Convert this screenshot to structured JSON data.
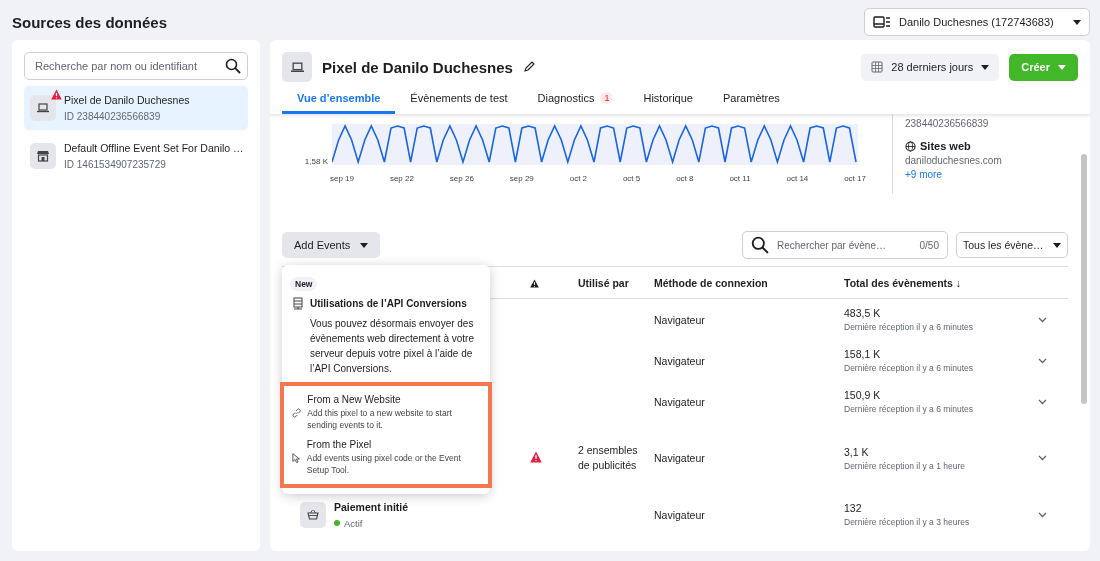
{
  "page_title": "Sources des données",
  "account": {
    "label": "Danilo Duchesnes (172743683)"
  },
  "sidebar": {
    "search": {
      "placeholder": "Recherche par nom ou identifiant"
    },
    "items": [
      {
        "kind": "pixel",
        "name": "Pixel de Danilo Duchesnes",
        "id": "ID 238440236566839",
        "selected": true,
        "warning": true
      },
      {
        "kind": "offline",
        "name": "Default Offline Event Set For Danilo …",
        "id": "ID 1461534907235729",
        "selected": false,
        "warning": false
      }
    ]
  },
  "main": {
    "title": "Pixel de Danilo Duchesnes",
    "date_range": "28 derniers jours",
    "create_button": "Créer",
    "tabs": [
      {
        "label": "Vue d’ensemble",
        "selected": true
      },
      {
        "label": "Évènements de test",
        "selected": false
      },
      {
        "label": "Diagnostics",
        "selected": false,
        "badge": "1"
      },
      {
        "label": "Historique",
        "selected": false
      },
      {
        "label": "Paramètres",
        "selected": false
      }
    ]
  },
  "chart": {
    "y_label": "1,58 K",
    "x_labels": [
      "sep 19",
      "sep 22",
      "sep 26",
      "sep 29",
      "oct 2",
      "oct 5",
      "oct 8",
      "oct 11",
      "oct 14",
      "oct 17"
    ]
  },
  "details": {
    "pixel_id": "238440236566839",
    "websites_title": "Sites web",
    "website": "daniloduchesnes.com",
    "more_link": "+9 more"
  },
  "toolbar": {
    "add_events": "Add Events",
    "search": {
      "placeholder": "Rechercher par évène…",
      "counter": "0/50"
    },
    "filter": "Tous les évène…"
  },
  "table": {
    "columns": [
      "Utilisé par",
      "Méthode de connexion",
      "Total des évènements ↓"
    ],
    "rows": [
      {
        "warning": false,
        "method": "Navigateur",
        "total": "483,5 K",
        "last_received": "Dernière réception il y a 6 minutes"
      },
      {
        "warning": false,
        "method": "Navigateur",
        "total": "158,1 K",
        "last_received": "Dernière réception il y a 6 minutes"
      },
      {
        "warning": false,
        "method": "Navigateur",
        "total": "150,9 K",
        "last_received": "Dernière réception il y a 6 minutes"
      },
      {
        "warning": true,
        "used_by": "2 ensembles de publicités",
        "method": "Navigateur",
        "total": "3,1 K",
        "last_received": "Dernière réception il y a 1 heure"
      },
      {
        "warning": false,
        "name": "Paiement initié",
        "status": "Actif",
        "active": true,
        "method": "Navigateur",
        "total": "132",
        "last_received": "Dernière réception il y a 3 heures"
      }
    ]
  },
  "dropdown": {
    "badge": "New",
    "title": "Utilisations de l’API Conversions",
    "description": "Vous pouvez désormais envoyer des évènements web directement à votre serveur depuis votre pixel à l’aide de l’API Conversions.",
    "options": [
      {
        "kind": "link",
        "title": "From a New Website",
        "description": "Add this pixel to a new website to start sending events to it."
      },
      {
        "kind": "pointer",
        "title": "From the Pixel",
        "description": "Add events using pixel code or the Event Setup Tool."
      }
    ]
  }
}
